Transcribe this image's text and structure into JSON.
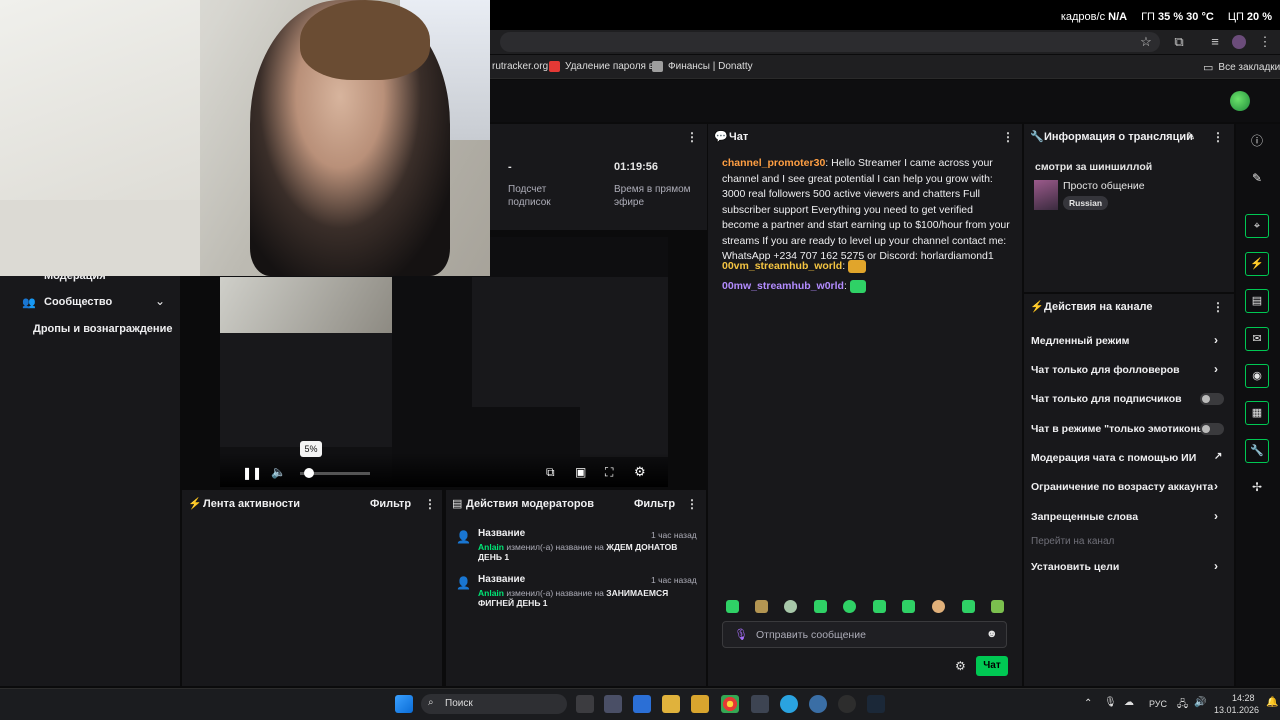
{
  "osd": {
    "fps_label": "кадров/с",
    "fps_value": "N/A",
    "gpu_label": "ГП",
    "gpu_load": "35 %",
    "gpu_temp": "30 °C",
    "cpu_label": "ЦП",
    "cpu_load": "20 %"
  },
  "bookmarks": [
    {
      "label": "rutracker.org",
      "color": "#3a8ee6"
    },
    {
      "label": "Удаление пароля в...",
      "color": "#e53935"
    },
    {
      "label": "Финансы | Donatty",
      "color": "#bdbdbd"
    }
  ],
  "all_bookmarks": "Все закладки",
  "stats": {
    "sub_count_value": "-",
    "sub_count_label": "Подсчет подписок",
    "live_time_value": "01:19:56",
    "live_time_label": "Время в прямом эфире"
  },
  "chat": {
    "title": "Чат",
    "messages": [
      {
        "user": "channel_promoter30",
        "user_color": "#ff9f43",
        "text": "Hello Streamer I came across your channel and I see great potential I can help you grow with: 3000 real followers 500 active viewers and chatters Full subscriber support Everything you need to get verified become a partner and start earning up to $100/hour from your streams If you are ready to level up your channel contact me: WhatsApp +234 707 162 5275 or Discord: horlardiamond1"
      },
      {
        "user": "00vm_streamhub_world",
        "user_color": "#f5c542",
        "text": ""
      },
      {
        "user": "00mw_streamhub_w0rld",
        "user_color": "#b38cff",
        "text": ""
      }
    ],
    "input_placeholder": "Отправить сообщение",
    "send_label": "Чат"
  },
  "info": {
    "title": "Информация о трансляции",
    "stream_title": "смотри за шиншиллой",
    "category": "Просто общение",
    "tag": "Russian"
  },
  "actions": {
    "title": "Действия на канале",
    "items": [
      {
        "label": "Медленный режим",
        "control": "arrow"
      },
      {
        "label": "Чат только для фолловеров",
        "control": "arrow"
      },
      {
        "label": "Чат только для подписчиков",
        "control": "toggle"
      },
      {
        "label": "Чат в режиме \"только эмотиконы\"",
        "control": "toggle"
      },
      {
        "label": "Модерация чата с помощью ИИ",
        "control": "external"
      },
      {
        "label": "Ограничение по возрасту аккаунта",
        "control": "arrow"
      },
      {
        "label": "Запрещенные слова",
        "control": "arrow"
      }
    ],
    "goto_channel": "Перейти на канал",
    "set_goals": "Установить цели"
  },
  "activity": {
    "title": "Лента активности",
    "filter": "Фильтр"
  },
  "mods": {
    "title": "Действия модераторов",
    "filter": "Фильтр",
    "items": [
      {
        "title": "Название",
        "time": "1 час назад",
        "user": "Anlain",
        "action": "изменил(-а) название на",
        "value": "ЖДЕМ ДОНАТОВ ДЕНЬ 1"
      },
      {
        "title": "Название",
        "time": "1 час назад",
        "user": "Anlain",
        "action": "изменил(-а) название на",
        "value": "ЗАНИМАЕМСЯ ФИГНЕЙ ДЕНЬ 1"
      }
    ]
  },
  "sidebar": {
    "items": [
      {
        "label": "Модерация"
      },
      {
        "label": "Сообщество"
      },
      {
        "label": "Дропы и вознаграждение"
      }
    ]
  },
  "player": {
    "volume_tooltip": "5%"
  },
  "taskbar": {
    "search_placeholder": "Поиск",
    "lang": "РУС",
    "time": "14:28",
    "date": "13.01.2026"
  }
}
